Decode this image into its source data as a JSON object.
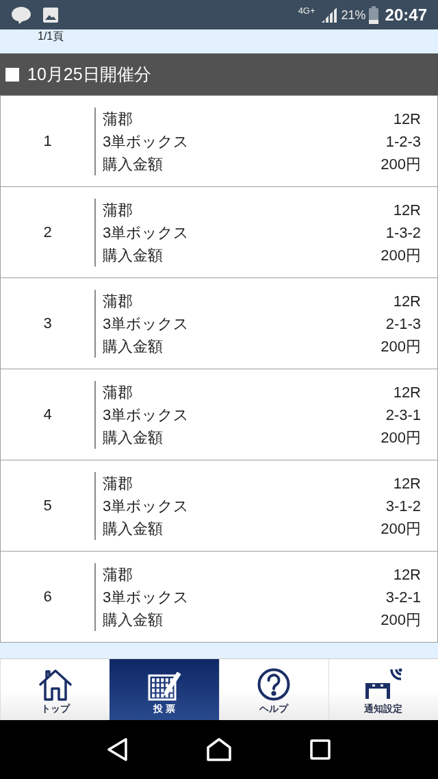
{
  "status_bar": {
    "network": "4G+",
    "battery": "21%",
    "time": "20:47"
  },
  "page": {
    "page_indicator": "1/1頁"
  },
  "section": {
    "title": "10月25日開催分"
  },
  "bets": [
    {
      "number": "1",
      "venue": "蒲郡",
      "race": "12R",
      "bet_type": "3単ボックス",
      "combination": "1-2-3",
      "amount_label": "購入金額",
      "amount": "200円"
    },
    {
      "number": "2",
      "venue": "蒲郡",
      "race": "12R",
      "bet_type": "3単ボックス",
      "combination": "1-3-2",
      "amount_label": "購入金額",
      "amount": "200円"
    },
    {
      "number": "3",
      "venue": "蒲郡",
      "race": "12R",
      "bet_type": "3単ボックス",
      "combination": "2-1-3",
      "amount_label": "購入金額",
      "amount": "200円"
    },
    {
      "number": "4",
      "venue": "蒲郡",
      "race": "12R",
      "bet_type": "3単ボックス",
      "combination": "2-3-1",
      "amount_label": "購入金額",
      "amount": "200円"
    },
    {
      "number": "5",
      "venue": "蒲郡",
      "race": "12R",
      "bet_type": "3単ボックス",
      "combination": "3-1-2",
      "amount_label": "購入金額",
      "amount": "200円"
    },
    {
      "number": "6",
      "venue": "蒲郡",
      "race": "12R",
      "bet_type": "3単ボックス",
      "combination": "3-2-1",
      "amount_label": "購入金額",
      "amount": "200円"
    }
  ],
  "bottom_nav": [
    {
      "kind": "home",
      "label": "トップ",
      "selected": false
    },
    {
      "kind": "vote",
      "label": "投 票",
      "selected": true
    },
    {
      "kind": "help",
      "label": "ヘルプ",
      "selected": false
    },
    {
      "kind": "notify",
      "label": "通知設定",
      "selected": false
    }
  ]
}
